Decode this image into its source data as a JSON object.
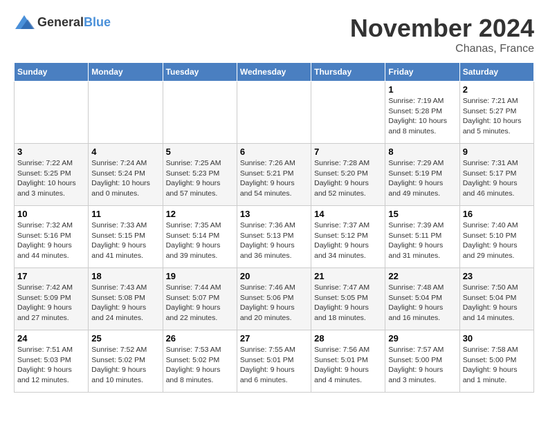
{
  "header": {
    "logo": {
      "general": "General",
      "blue": "Blue"
    },
    "title": "November 2024",
    "location": "Chanas, France"
  },
  "calendar": {
    "days_of_week": [
      "Sunday",
      "Monday",
      "Tuesday",
      "Wednesday",
      "Thursday",
      "Friday",
      "Saturday"
    ],
    "weeks": [
      [
        {
          "day": "",
          "info": ""
        },
        {
          "day": "",
          "info": ""
        },
        {
          "day": "",
          "info": ""
        },
        {
          "day": "",
          "info": ""
        },
        {
          "day": "",
          "info": ""
        },
        {
          "day": "1",
          "info": "Sunrise: 7:19 AM\nSunset: 5:28 PM\nDaylight: 10 hours\nand 8 minutes."
        },
        {
          "day": "2",
          "info": "Sunrise: 7:21 AM\nSunset: 5:27 PM\nDaylight: 10 hours\nand 5 minutes."
        }
      ],
      [
        {
          "day": "3",
          "info": "Sunrise: 7:22 AM\nSunset: 5:25 PM\nDaylight: 10 hours\nand 3 minutes."
        },
        {
          "day": "4",
          "info": "Sunrise: 7:24 AM\nSunset: 5:24 PM\nDaylight: 10 hours\nand 0 minutes."
        },
        {
          "day": "5",
          "info": "Sunrise: 7:25 AM\nSunset: 5:23 PM\nDaylight: 9 hours\nand 57 minutes."
        },
        {
          "day": "6",
          "info": "Sunrise: 7:26 AM\nSunset: 5:21 PM\nDaylight: 9 hours\nand 54 minutes."
        },
        {
          "day": "7",
          "info": "Sunrise: 7:28 AM\nSunset: 5:20 PM\nDaylight: 9 hours\nand 52 minutes."
        },
        {
          "day": "8",
          "info": "Sunrise: 7:29 AM\nSunset: 5:19 PM\nDaylight: 9 hours\nand 49 minutes."
        },
        {
          "day": "9",
          "info": "Sunrise: 7:31 AM\nSunset: 5:17 PM\nDaylight: 9 hours\nand 46 minutes."
        }
      ],
      [
        {
          "day": "10",
          "info": "Sunrise: 7:32 AM\nSunset: 5:16 PM\nDaylight: 9 hours\nand 44 minutes."
        },
        {
          "day": "11",
          "info": "Sunrise: 7:33 AM\nSunset: 5:15 PM\nDaylight: 9 hours\nand 41 minutes."
        },
        {
          "day": "12",
          "info": "Sunrise: 7:35 AM\nSunset: 5:14 PM\nDaylight: 9 hours\nand 39 minutes."
        },
        {
          "day": "13",
          "info": "Sunrise: 7:36 AM\nSunset: 5:13 PM\nDaylight: 9 hours\nand 36 minutes."
        },
        {
          "day": "14",
          "info": "Sunrise: 7:37 AM\nSunset: 5:12 PM\nDaylight: 9 hours\nand 34 minutes."
        },
        {
          "day": "15",
          "info": "Sunrise: 7:39 AM\nSunset: 5:11 PM\nDaylight: 9 hours\nand 31 minutes."
        },
        {
          "day": "16",
          "info": "Sunrise: 7:40 AM\nSunset: 5:10 PM\nDaylight: 9 hours\nand 29 minutes."
        }
      ],
      [
        {
          "day": "17",
          "info": "Sunrise: 7:42 AM\nSunset: 5:09 PM\nDaylight: 9 hours\nand 27 minutes."
        },
        {
          "day": "18",
          "info": "Sunrise: 7:43 AM\nSunset: 5:08 PM\nDaylight: 9 hours\nand 24 minutes."
        },
        {
          "day": "19",
          "info": "Sunrise: 7:44 AM\nSunset: 5:07 PM\nDaylight: 9 hours\nand 22 minutes."
        },
        {
          "day": "20",
          "info": "Sunrise: 7:46 AM\nSunset: 5:06 PM\nDaylight: 9 hours\nand 20 minutes."
        },
        {
          "day": "21",
          "info": "Sunrise: 7:47 AM\nSunset: 5:05 PM\nDaylight: 9 hours\nand 18 minutes."
        },
        {
          "day": "22",
          "info": "Sunrise: 7:48 AM\nSunset: 5:04 PM\nDaylight: 9 hours\nand 16 minutes."
        },
        {
          "day": "23",
          "info": "Sunrise: 7:50 AM\nSunset: 5:04 PM\nDaylight: 9 hours\nand 14 minutes."
        }
      ],
      [
        {
          "day": "24",
          "info": "Sunrise: 7:51 AM\nSunset: 5:03 PM\nDaylight: 9 hours\nand 12 minutes."
        },
        {
          "day": "25",
          "info": "Sunrise: 7:52 AM\nSunset: 5:02 PM\nDaylight: 9 hours\nand 10 minutes."
        },
        {
          "day": "26",
          "info": "Sunrise: 7:53 AM\nSunset: 5:02 PM\nDaylight: 9 hours\nand 8 minutes."
        },
        {
          "day": "27",
          "info": "Sunrise: 7:55 AM\nSunset: 5:01 PM\nDaylight: 9 hours\nand 6 minutes."
        },
        {
          "day": "28",
          "info": "Sunrise: 7:56 AM\nSunset: 5:01 PM\nDaylight: 9 hours\nand 4 minutes."
        },
        {
          "day": "29",
          "info": "Sunrise: 7:57 AM\nSunset: 5:00 PM\nDaylight: 9 hours\nand 3 minutes."
        },
        {
          "day": "30",
          "info": "Sunrise: 7:58 AM\nSunset: 5:00 PM\nDaylight: 9 hours\nand 1 minute."
        }
      ]
    ]
  }
}
